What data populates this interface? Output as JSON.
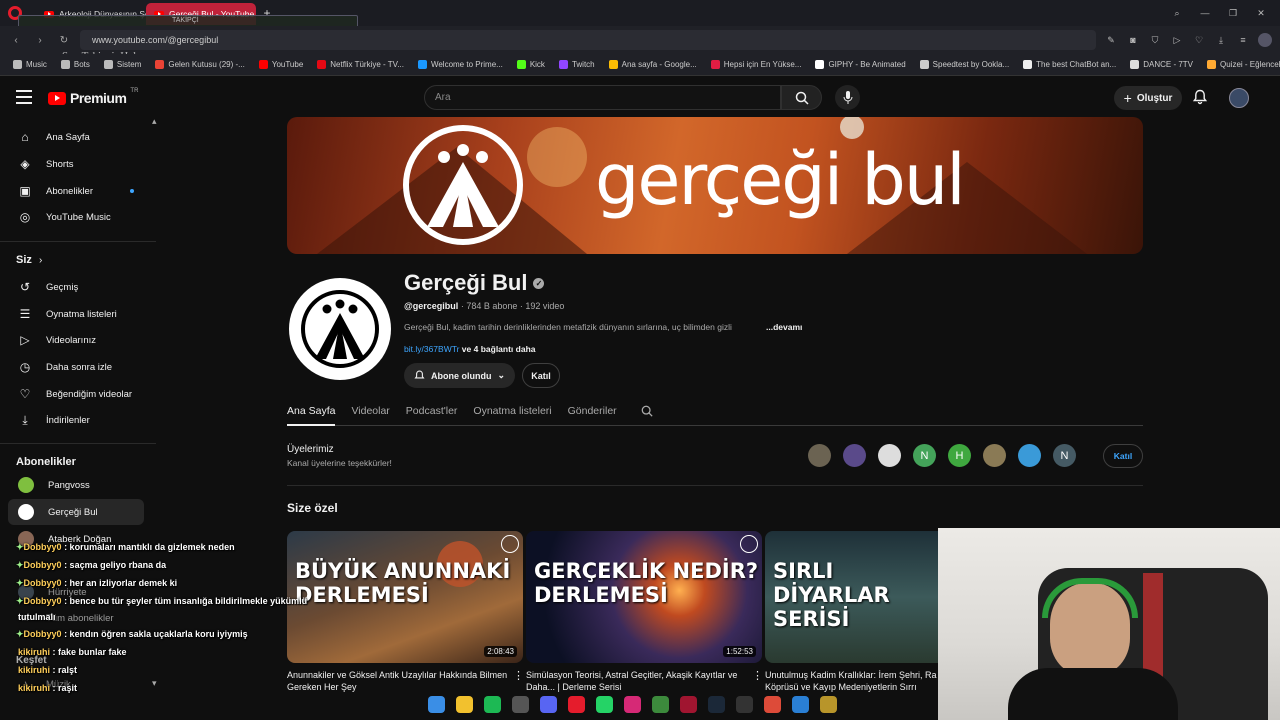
{
  "browser": {
    "tabs": [
      {
        "label": "Arkeoloji Dünyasının Şok"
      },
      {
        "label": "Gerçeği Bul - YouTube"
      }
    ],
    "new_tab_symbol": "+",
    "url": "www.youtube.com/@gercegibul",
    "bookmarks": [
      {
        "label": "Music",
        "color": "#bbbbbb"
      },
      {
        "label": "Bots",
        "color": "#bbbbbb"
      },
      {
        "label": "Sistem",
        "color": "#bbbbbb"
      },
      {
        "label": "Gelen Kutusu (29) -...",
        "color": "#ea4335"
      },
      {
        "label": "YouTube",
        "color": "#ff0000"
      },
      {
        "label": "Netflix Türkiye - TV...",
        "color": "#e50914"
      },
      {
        "label": "Welcome to Prime...",
        "color": "#1a98ff"
      },
      {
        "label": "Kick",
        "color": "#53fc18"
      },
      {
        "label": "Twitch",
        "color": "#9146ff"
      },
      {
        "label": "Ana sayfa - Google...",
        "color": "#fbbc04"
      },
      {
        "label": "Hepsi için En Yükse...",
        "color": "#e01d43"
      },
      {
        "label": "GIPHY - Be Animated",
        "color": "#ffffff"
      },
      {
        "label": "Speedtest by Ookla...",
        "color": "#cccccc"
      },
      {
        "label": "The best ChatBot an...",
        "color": "#eeeeee"
      },
      {
        "label": "DANCE - 7TV",
        "color": "#dddddd"
      },
      {
        "label": "Quizei - Eğlenceli ve...",
        "color": "#ffaa33"
      }
    ]
  },
  "overlay": {
    "follower_label": "TAKİPÇİ",
    "last_follower": "Son Takipçi: Helany"
  },
  "header": {
    "logo_text": "Premium",
    "logo_region": "TR",
    "search_placeholder": "Ara",
    "create_label": "Oluştur"
  },
  "sidebar": {
    "main": [
      {
        "label": "Ana Sayfa",
        "icon": "home-icon"
      },
      {
        "label": "Shorts",
        "icon": "shorts-icon"
      },
      {
        "label": "Abonelikler",
        "icon": "subscriptions-icon"
      },
      {
        "label": "YouTube Music",
        "icon": "music-icon"
      }
    ],
    "you_title": "Siz",
    "you": [
      {
        "label": "Geçmiş",
        "icon": "history-icon"
      },
      {
        "label": "Oynatma listeleri",
        "icon": "playlists-icon"
      },
      {
        "label": "Videolarınız",
        "icon": "your-videos-icon"
      },
      {
        "label": "Daha sonra izle",
        "icon": "watch-later-icon"
      },
      {
        "label": "Beğendiğim videolar",
        "icon": "liked-icon"
      },
      {
        "label": "İndirilenler",
        "icon": "downloads-icon"
      }
    ],
    "subs_title": "Abonelikler",
    "subs": [
      {
        "label": "Pangvoss",
        "color": "#7fbf3f"
      },
      {
        "label": "Gerçeği Bul",
        "color": "#ffffff"
      },
      {
        "label": "Ataberk Doğan",
        "color": "#886655"
      },
      {
        "label": "Hürriyete",
        "color": "#556677"
      }
    ],
    "all_subs": "Tüm abonelikler",
    "explore_title": "Keşfet",
    "music": "Müzik"
  },
  "channel": {
    "banner_text": "gerçeği bul",
    "name": "Gerçeği Bul",
    "handle": "@gercegibul",
    "subs": "784 B abone",
    "videos": "192 video",
    "sep": "·",
    "description": "Gerçeği Bul, kadim tarihin derinliklerinden metafizik dünyanın sırlarına, uç bilimden gizli",
    "more": "...devamı",
    "link": "bit.ly/367BWTr",
    "links_more": "ve 4 bağlantı daha",
    "subscribe_label": "Abone olundu",
    "join_label": "Katıl"
  },
  "tabs": [
    "Ana Sayfa",
    "Videolar",
    "Podcast'ler",
    "Oynatma listeleri",
    "Gönderiler"
  ],
  "members": {
    "title": "Üyelerimiz",
    "subtitle": "Kanal üyelerine teşekkürler!",
    "avatars": [
      {
        "letter": "",
        "color": "#6b6352"
      },
      {
        "letter": "",
        "color": "#5a4a8a"
      },
      {
        "letter": "",
        "color": "#dddddd"
      },
      {
        "letter": "N",
        "color": "#44a35a"
      },
      {
        "letter": "H",
        "color": "#3fa83f"
      },
      {
        "letter": "",
        "color": "#8a7a55"
      },
      {
        "letter": "",
        "color": "#3a9ad8"
      },
      {
        "letter": "N",
        "color": "#455a64"
      }
    ],
    "join_label": "Katıl"
  },
  "for_you": {
    "title": "Size özel",
    "videos": [
      {
        "thumb_text": "BÜYÜK ANUNNAKİ DERLEMESİ",
        "duration": "2:08:43",
        "title": "Anunnakiler ve Göksel Antik Uzaylılar Hakkında Bilmen Gereken Her Şey"
      },
      {
        "thumb_text": "GERÇEKLİK NEDİR? DERLEMESİ",
        "duration": "1:52:53",
        "title": "Simülasyon Teorisi, Astral Geçitler, Akaşik Kayıtlar ve Daha... | Derleme Serisi"
      },
      {
        "thumb_text": "SIRLI DİYARLAR SERİSİ",
        "duration": "",
        "title": "Unutulmuş Kadim Krallıklar: İrem Şehri, Ra Köprüsü ve Kayıp Medeniyetlerin Sırrı"
      }
    ]
  },
  "chat": [
    {
      "user": "Dobbyy0",
      "msg": " : korumaları mantıklı da gizlemek neden",
      "star": true
    },
    {
      "user": "Dobbyy0",
      "msg": " : saçma geliyo rbana da",
      "star": true
    },
    {
      "user": "Dobbyy0",
      "msg": " : her an izliyorlar demek ki",
      "star": true
    },
    {
      "user": "Dobbyy0",
      "msg": " : bence bu tür şeyler tüm insanlığa bildirilmekle yükümlü",
      "star": true
    },
    {
      "user": "",
      "msg": "tutulmalı",
      "star": false
    },
    {
      "user": "Dobbyy0",
      "msg": " : kendın öğren sakla uçaklarla koru iyiymiş",
      "star": true
    },
    {
      "user": "kikiruhi",
      "msg": " : fake bunlar fake",
      "star": false
    },
    {
      "user": "kikiruhi",
      "msg": " : ralşt",
      "star": false
    },
    {
      "user": "kikiruhi",
      "msg": " : raşit",
      "star": false
    }
  ],
  "taskbar": [
    {
      "name": "windows-start",
      "color": "#3a8ee6"
    },
    {
      "name": "file-explorer",
      "color": "#f2c12e"
    },
    {
      "name": "spotify",
      "color": "#1db954"
    },
    {
      "name": "obs",
      "color": "#555555"
    },
    {
      "name": "discord",
      "color": "#5865f2"
    },
    {
      "name": "opera",
      "color": "#e51c2c"
    },
    {
      "name": "whatsapp",
      "color": "#25d366"
    },
    {
      "name": "instagram",
      "color": "#d62976"
    },
    {
      "name": "notepad",
      "color": "#3c8a3c"
    },
    {
      "name": "app-red",
      "color": "#a01530"
    },
    {
      "name": "steam",
      "color": "#1b2838"
    },
    {
      "name": "epic",
      "color": "#333333"
    },
    {
      "name": "chrome",
      "color": "#dd4b39"
    },
    {
      "name": "app-blue",
      "color": "#2a7fd4"
    },
    {
      "name": "app-gold",
      "color": "#b8952a"
    }
  ]
}
